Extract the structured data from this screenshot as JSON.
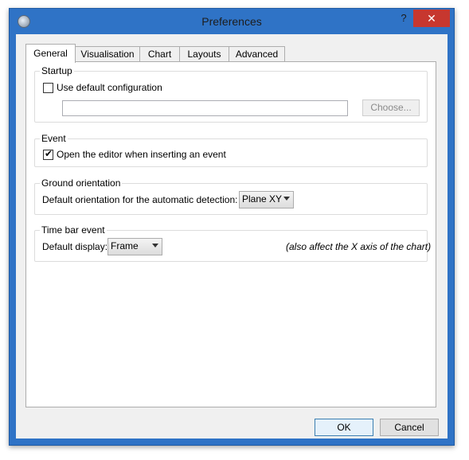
{
  "window": {
    "title": "Preferences",
    "help": "?",
    "close": "✕"
  },
  "tabs": [
    {
      "label": "General"
    },
    {
      "label": "Visualisation"
    },
    {
      "label": "Chart"
    },
    {
      "label": "Layouts"
    },
    {
      "label": "Advanced"
    }
  ],
  "startup": {
    "legend": "Startup",
    "use_default_label": "Use default configuration",
    "use_default_checked": false,
    "path_value": "",
    "choose_button": "Choose..."
  },
  "event": {
    "legend": "Event",
    "open_editor_label": "Open the editor when inserting an event",
    "open_editor_checked": true
  },
  "ground": {
    "legend": "Ground orientation",
    "label": "Default orientation for the automatic detection:",
    "value": "Plane XY"
  },
  "timebar": {
    "legend": "Time bar event",
    "label": "Default display:",
    "value": "Frame",
    "note": "(also affect the X axis of the chart)"
  },
  "buttons": {
    "ok": "OK",
    "cancel": "Cancel"
  },
  "icons": {
    "app": "app-icon",
    "checkmark": "✔"
  }
}
